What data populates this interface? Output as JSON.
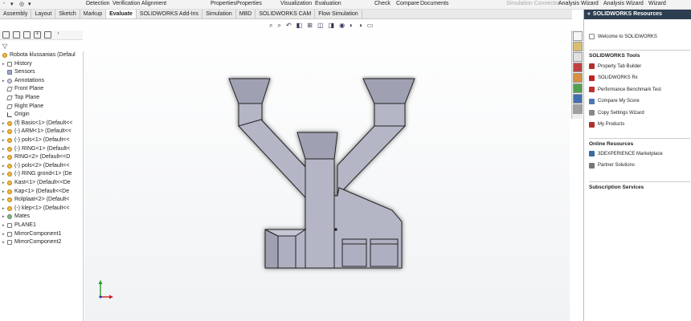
{
  "ribbon": {
    "quick_icons": [
      "-",
      "▾",
      "◎",
      "▾"
    ],
    "items": [
      "Detection",
      "Verification",
      "Alignment",
      "Properties",
      "Properties",
      "Visualization",
      "Evaluation",
      "Check",
      "Compare",
      "Documents",
      "Simulation Connector",
      "Analysis Wizard",
      "Analysis Wizard",
      "Wizard"
    ]
  },
  "tabs": [
    "Assembly",
    "Layout",
    "Sketch",
    "Markup",
    "Evaluate",
    "SOLIDWORKS Add-Ins",
    "Simulation",
    "MBD",
    "SOLIDWORKS CAM",
    "Flow Simulation"
  ],
  "active_tab": "Evaluate",
  "tree": {
    "root": "Robota klussanias  (Defaul",
    "items": [
      {
        "label": "History",
        "icon": "doc"
      },
      {
        "label": "Sensors",
        "icon": "sens"
      },
      {
        "label": "Annotations",
        "icon": "ann"
      },
      {
        "label": "Front Plane",
        "icon": "plane"
      },
      {
        "label": "Top Plane",
        "icon": "plane"
      },
      {
        "label": "Right Plane",
        "icon": "plane"
      },
      {
        "label": "Origin",
        "icon": "origin"
      },
      {
        "label": "(f) Basis<1> (Default<<",
        "icon": "part"
      },
      {
        "label": "(-) ARM<1> (Default<<",
        "icon": "part"
      },
      {
        "label": "(-) pols<1> (Default<<",
        "icon": "part"
      },
      {
        "label": "(-) RING<1> (Default<",
        "icon": "part"
      },
      {
        "label": "RING<2> (Default<<D",
        "icon": "part"
      },
      {
        "label": "(-) pols<2> (Default<<",
        "icon": "part"
      },
      {
        "label": "(-) RING grond<1> (De",
        "icon": "part"
      },
      {
        "label": "Kast<1> (Default<<De",
        "icon": "part"
      },
      {
        "label": "Kap<1> (Default<<De",
        "icon": "part"
      },
      {
        "label": "Rolplaat<2> (Default<",
        "icon": "part"
      },
      {
        "label": "(-) klep<1> (Default<<",
        "icon": "part"
      },
      {
        "label": "Mates",
        "icon": "mates"
      },
      {
        "label": "PLANE1",
        "icon": "doc"
      },
      {
        "label": "MirrorComponent1",
        "icon": "doc"
      },
      {
        "label": "MirrorComponent2",
        "icon": "doc"
      }
    ]
  },
  "taskpane": {
    "title": "SOLIDWORKS Resources",
    "welcome": "Welcome to SOLIDWORKS",
    "tools_header": "SOLIDWORKS Tools",
    "tools": [
      {
        "label": "Property Tab Builder",
        "color": "#b03030"
      },
      {
        "label": "SOLIDWORKS Rx",
        "color": "#c02020"
      },
      {
        "label": "Performance Benchmark Test",
        "color": "#c03030"
      },
      {
        "label": "Compare My Score",
        "color": "#4a78b0"
      },
      {
        "label": "Copy Settings Wizard",
        "color": "#888888"
      },
      {
        "label": "My Products",
        "color": "#b03030"
      }
    ],
    "online_header": "Online Resources",
    "online": [
      {
        "label": "3DEXPERIENCE Marketplace",
        "color": "#3a6aa0"
      },
      {
        "label": "Partner Solutions",
        "color": "#777777"
      }
    ],
    "subscription_header": "Subscription Services"
  },
  "colors": {
    "tab_active_bg": "#ffffff",
    "taskpane_header": "#2c3e50",
    "model_face": "#b4b6c6",
    "model_edge": "#222222"
  }
}
